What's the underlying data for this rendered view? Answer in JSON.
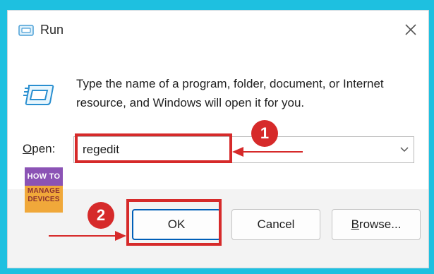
{
  "window": {
    "title": "Run"
  },
  "dialog": {
    "description": "Type the name of a program, folder, document, or Internet resource, and Windows will open it for you.",
    "open_label_underlined": "O",
    "open_label_rest": "pen:",
    "open_value": "regedit"
  },
  "buttons": {
    "ok": "OK",
    "cancel": "Cancel",
    "browse_underlined": "B",
    "browse_rest": "rowse..."
  },
  "annotations": {
    "step1": "1",
    "step2": "2",
    "accent_color": "#d62a2a"
  },
  "logo": {
    "line1": "HOW TO",
    "line2": "MANAGE",
    "line3": "DEVICES"
  },
  "colors": {
    "background": "#1ec0e0",
    "ok_border": "#005fb8",
    "footer": "#f3f3f3"
  }
}
